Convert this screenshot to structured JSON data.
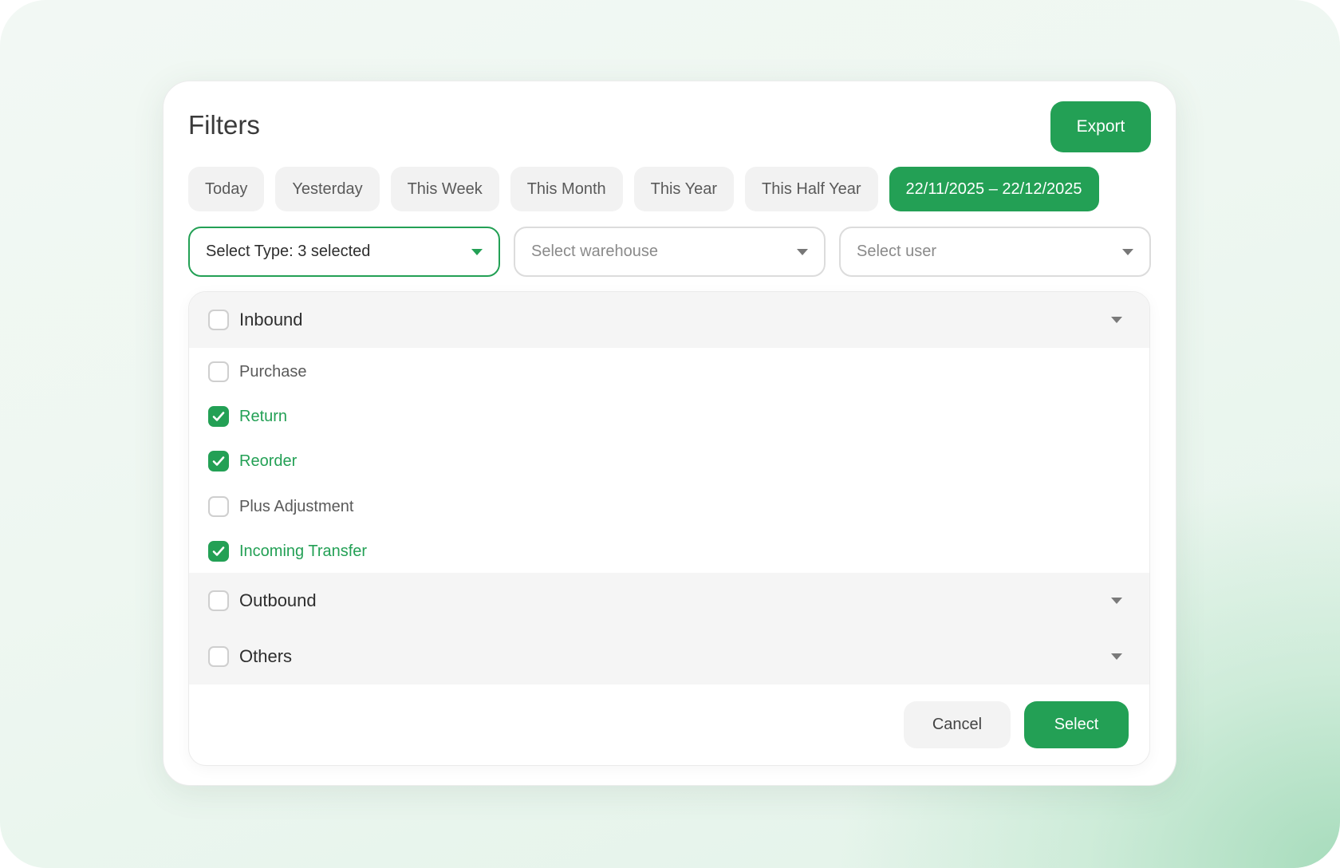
{
  "header": {
    "title": "Filters",
    "export_label": "Export"
  },
  "date_chips": [
    {
      "label": "Today",
      "active": false
    },
    {
      "label": "Yesterday",
      "active": false
    },
    {
      "label": "This Week",
      "active": false
    },
    {
      "label": "This Month",
      "active": false
    },
    {
      "label": "This Year",
      "active": false
    },
    {
      "label": "This Half Year",
      "active": false
    },
    {
      "label": "22/11/2025 – 22/12/2025",
      "active": true
    }
  ],
  "selects": {
    "type": {
      "label": "Select Type: 3 selected"
    },
    "warehouse": {
      "placeholder": "Select warehouse"
    },
    "user": {
      "placeholder": "Select user"
    }
  },
  "type_panel": {
    "groups": [
      {
        "label": "Inbound",
        "checked": false,
        "expanded": true,
        "items": [
          {
            "label": "Purchase",
            "checked": false
          },
          {
            "label": "Return",
            "checked": true
          },
          {
            "label": "Reorder",
            "checked": true
          },
          {
            "label": "Plus Adjustment",
            "checked": false
          },
          {
            "label": "Incoming Transfer",
            "checked": true
          }
        ]
      },
      {
        "label": "Outbound",
        "checked": false,
        "expanded": false,
        "items": []
      },
      {
        "label": "Others",
        "checked": false,
        "expanded": false,
        "items": []
      }
    ],
    "cancel_label": "Cancel",
    "select_label": "Select"
  },
  "colors": {
    "accent": "#23a055",
    "chip_bg": "#f2f2f2",
    "group_bg": "#f5f5f5"
  },
  "icons": {
    "dropdown": "caret-down-icon",
    "check": "checkmark-icon"
  }
}
